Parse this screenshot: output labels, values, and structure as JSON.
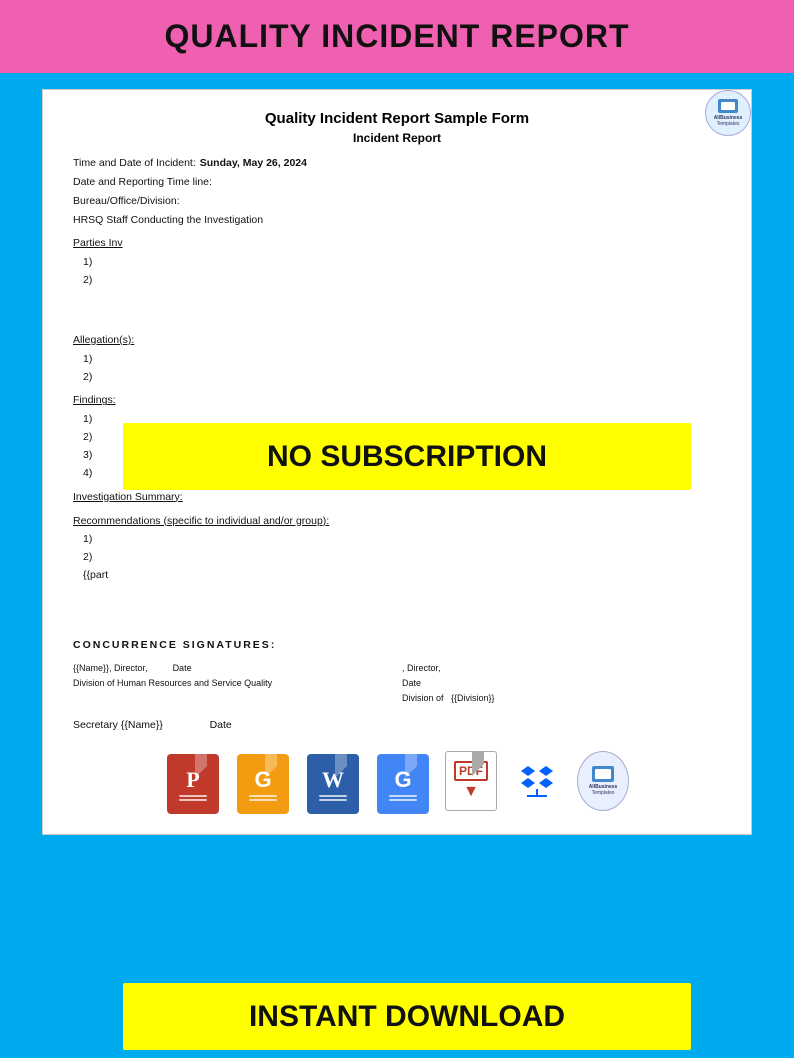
{
  "page": {
    "background_color": "#00aaee"
  },
  "header": {
    "title": "QUALITY INCIDENT REPORT",
    "background": "#f060b0"
  },
  "document": {
    "title": "Quality Incident Report Sample Form",
    "subtitle": "Incident Report",
    "fields": {
      "time_date_label": "Time and Date of Incident:",
      "time_date_value": "Sunday, May 26, 2024",
      "date_reporting_label": "Date and Reporting Time line:",
      "bureau_label": "Bureau/Office/Division:",
      "hrsq_label": "HRSQ Staff Conducting the Investigation"
    },
    "parties_section": {
      "title": "Parties Inv",
      "items": [
        "1)",
        "2)"
      ]
    },
    "allegations_section": {
      "title": "Allegation(s):",
      "items": [
        "1)",
        "2)"
      ]
    },
    "findings_section": {
      "title": "Findings:",
      "items": [
        "1)",
        "2)",
        "3)",
        "4)"
      ]
    },
    "investigation_summary": {
      "title": "Investigation Summary:"
    },
    "recommendations_section": {
      "title": "Recommendations (specific to individual and/or group):",
      "items": [
        "1)",
        "2)"
      ]
    },
    "template_part": "{{part",
    "concurrence_header": "CONCURRENCE  SIGNATURES:",
    "sig1_name": "{{Name}}",
    "sig1_role": ", Director,",
    "sig1_date_label": "Date",
    "sig1_division": "Division of Human Resources and Service Quality",
    "sig2_role": ", Director,",
    "sig2_date_label": "Date",
    "sig2_division_label": "Division of",
    "sig2_division_value": "{{Division}}",
    "sig3_label": "Secretary",
    "sig3_name": "{{Name}}",
    "sig3_date": "Date"
  },
  "overlay_banners": {
    "no_subscription": "NO SUBSCRIPTION",
    "instant_download": "INSTANT DOWNLOAD"
  },
  "allbiz_logo": {
    "line1": "AllBusiness",
    "line2": "Templates"
  },
  "file_icons": [
    {
      "name": "PowerPoint",
      "letter": "P",
      "color": "#c0392b",
      "type": "ppt"
    },
    {
      "name": "Google Slides",
      "letter": "G",
      "color": "#f39c12",
      "type": "slides"
    },
    {
      "name": "Word",
      "letter": "W",
      "color": "#2c5fa8",
      "type": "word"
    },
    {
      "name": "Google Docs",
      "letter": "G",
      "color": "#4285f4",
      "type": "docs"
    },
    {
      "name": "PDF",
      "type": "pdf"
    },
    {
      "name": "Dropbox",
      "type": "dropbox"
    },
    {
      "name": "AllBusiness Templates",
      "type": "allbiz"
    }
  ]
}
